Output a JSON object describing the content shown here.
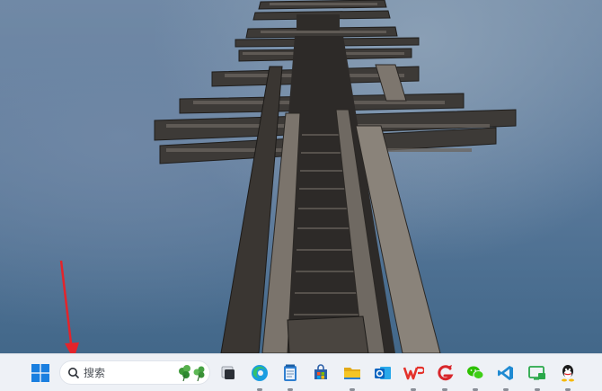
{
  "wallpaper": {
    "description_icon": "wooden-pier-wallpaper"
  },
  "annotation": {
    "arrow_color": "#e3242b"
  },
  "taskbar": {
    "start_icon": "windows-icon",
    "search": {
      "placeholder": "搜索",
      "icon": "search-icon",
      "decoration": "clover-highlight-icon"
    },
    "apps": [
      {
        "name": "task-view-icon",
        "running": false
      },
      {
        "name": "edge-icon",
        "running": true
      },
      {
        "name": "notepad-icon",
        "running": true
      },
      {
        "name": "microsoft-store-icon",
        "running": false
      },
      {
        "name": "file-explorer-icon",
        "running": true
      },
      {
        "name": "outlook-icon",
        "running": false
      },
      {
        "name": "wps-office-icon",
        "running": true
      },
      {
        "name": "app-g-icon",
        "running": true
      },
      {
        "name": "wechat-icon",
        "running": true
      },
      {
        "name": "vscode-icon",
        "running": true
      },
      {
        "name": "remote-screen-icon",
        "running": true
      },
      {
        "name": "qq-icon",
        "running": true
      }
    ],
    "colors": {
      "background": "#eef1f6",
      "windows_blue": "#1a7fe0",
      "wps_red": "#e4322b",
      "wechat_green": "#2dc100",
      "vscode_blue": "#1f8ad2",
      "explorer_yellow": "#f5c526"
    }
  }
}
